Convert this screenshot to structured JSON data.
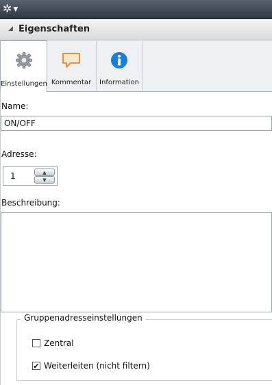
{
  "toolbar": {
    "gear_icon": "gear-icon",
    "dropdown_caret": "▼"
  },
  "section": {
    "collapse_glyph": "◢",
    "title": "Eigenschaften"
  },
  "tabs": [
    {
      "label": "Einstellungen",
      "icon": "gear-icon",
      "active": true
    },
    {
      "label": "Kommentar",
      "icon": "speech-bubble-icon",
      "active": false
    },
    {
      "label": "Information",
      "icon": "info-icon",
      "active": false
    }
  ],
  "form": {
    "name_label": "Name:",
    "name_value": "ON/OFF",
    "address_label": "Adresse:",
    "address_value": "1",
    "description_label": "Beschreibung:",
    "description_value": ""
  },
  "group": {
    "title": "Gruppenadresseinstellungen",
    "options": [
      {
        "label": "Zentral",
        "checked": false,
        "check_glyph": ""
      },
      {
        "label": "Weiterleiten (nicht filtern)",
        "checked": true,
        "check_glyph": "✔"
      }
    ]
  },
  "colors": {
    "toolbar": "#2f3741",
    "info_blue": "#1a7fd6",
    "comment_orange": "#e8923a"
  }
}
